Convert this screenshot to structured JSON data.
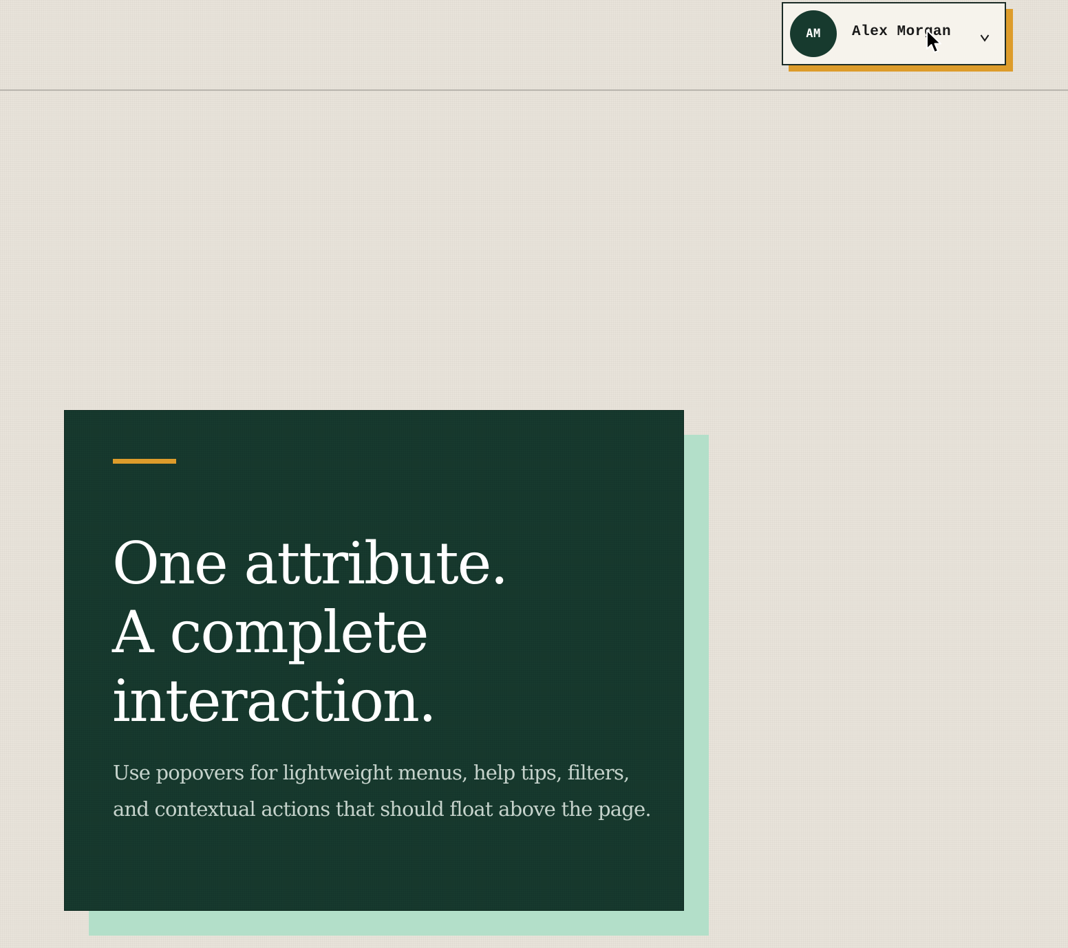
{
  "header": {
    "user_menu": {
      "avatar_initials": "AM",
      "user_name": "Alex Morgan",
      "dropdown_icon": "chevron-down-icon"
    }
  },
  "hero": {
    "title_lines": [
      "One attribute.",
      "A complete",
      "interaction."
    ],
    "description": "Use popovers for lightweight menus, help tips, filters, and contextual actions that should float above the page."
  },
  "colors": {
    "page_background": "#e8e3da",
    "card_background": "#173a2e",
    "accent": "#dd9c2b",
    "card_shadow": "#b3dfc9",
    "user_menu_background": "#f6f3ec"
  }
}
